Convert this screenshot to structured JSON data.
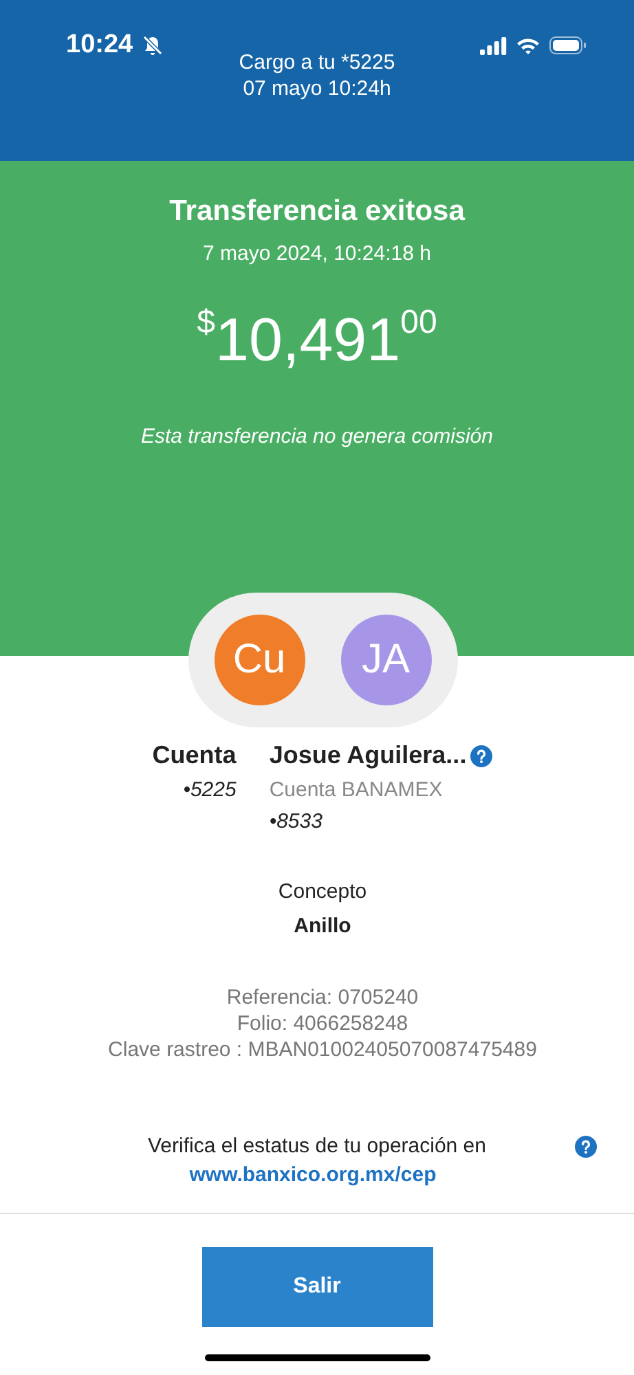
{
  "status_bar": {
    "time": "10:24",
    "silent": true
  },
  "header": {
    "line1": "Cargo a tu *5225",
    "line2": "07 mayo 10:24h"
  },
  "result": {
    "title": "Transferencia exitosa",
    "datetime": "7 mayo 2024, 10:24:18 h",
    "amount": {
      "currency": "$",
      "integer": "10,491",
      "cents": "00"
    },
    "note": "Esta transferencia no genera comisión"
  },
  "parties": [
    {
      "initials": "Cu",
      "color": "#f07d2a",
      "name": "Cuenta",
      "account": "•5225"
    },
    {
      "initials": "JA",
      "color": "#a796e8",
      "name": "Josue Aguilera...",
      "bank": "Cuenta BANAMEX",
      "account": "•8533",
      "help": true
    }
  ],
  "concept": {
    "label": "Concepto",
    "value": "Anillo"
  },
  "references": [
    "Referencia: 0705240",
    "Folio: 4066258248",
    "Clave rastreo : MBAN01002405070087475489"
  ],
  "verify": {
    "text": "Verifica el estatus de tu operación en",
    "link": "www.banxico.org.mx/cep"
  },
  "button": "Salir"
}
